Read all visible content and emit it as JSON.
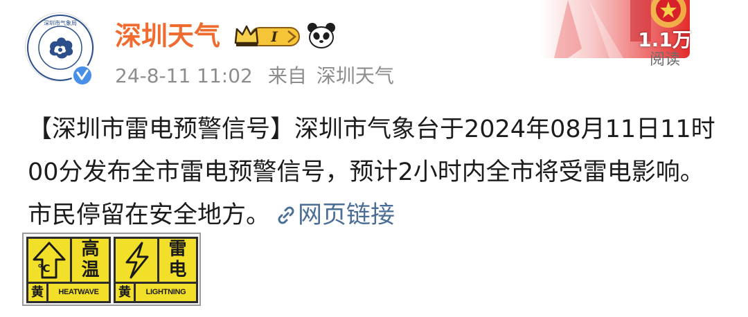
{
  "account": {
    "name": "深圳天气",
    "avatar_text": "深圳市气象局",
    "verified": true,
    "vip_level": "I"
  },
  "post_meta": {
    "date": "24-8-11 11:02",
    "source_label": "来自",
    "source_name": "深圳天气"
  },
  "stats": {
    "reads": "1.1万",
    "reads_label": "阅读"
  },
  "post": {
    "text": "【深圳市雷电预警信号】深圳市气象台于2024年08月11日11时00分发布全市雷电预警信号，预计2小时内全市将受雷电影响。市民停留在安全地方。",
    "link_label": "网页链接"
  },
  "signals": [
    {
      "name_line1": "高",
      "name_line2": "温",
      "level": "黄",
      "en": "HEATWAVE",
      "symbol": "°C"
    },
    {
      "name_line1": "雷",
      "name_line2": "电",
      "level": "黄",
      "en": "LIGHTNING",
      "symbol": "lightning-bolt"
    }
  ],
  "colors": {
    "username": "#ef6b2f",
    "meta": "#8d8d8d",
    "link": "#4a6e96",
    "signal_yellow": "#f2df2a",
    "verified_blue": "#4a8fe7"
  }
}
